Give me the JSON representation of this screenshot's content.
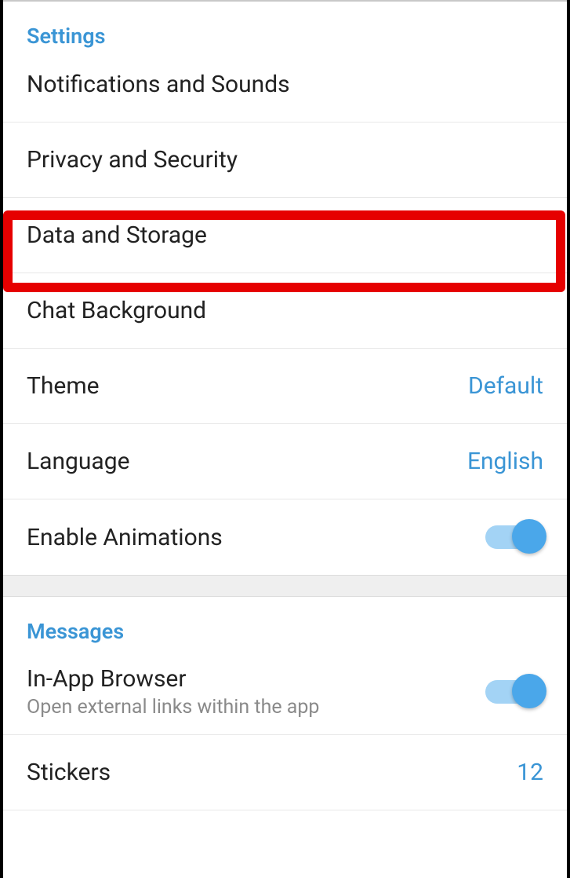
{
  "settings": {
    "header": "Settings",
    "items": {
      "notifications": "Notifications and Sounds",
      "privacy": "Privacy and Security",
      "data_storage": "Data and Storage",
      "chat_background": "Chat Background",
      "theme_label": "Theme",
      "theme_value": "Default",
      "language_label": "Language",
      "language_value": "English",
      "animations_label": "Enable Animations"
    }
  },
  "messages": {
    "header": "Messages",
    "items": {
      "browser_label": "In-App Browser",
      "browser_subtitle": "Open external links within the app",
      "stickers_label": "Stickers",
      "stickers_value": "12"
    }
  }
}
